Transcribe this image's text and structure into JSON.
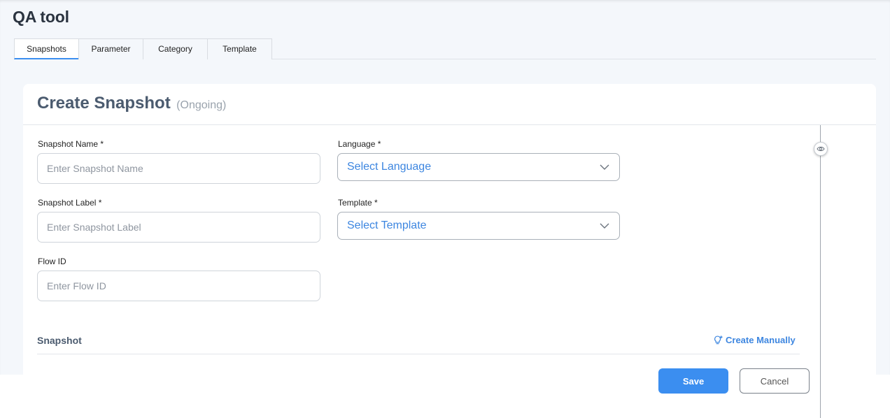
{
  "app": {
    "title": "QA tool"
  },
  "tabs": [
    {
      "label": "Snapshots",
      "active": true
    },
    {
      "label": "Parameter",
      "active": false
    },
    {
      "label": "Category",
      "active": false
    },
    {
      "label": "Template",
      "active": false
    }
  ],
  "card": {
    "title": "Create Snapshot",
    "status": "(Ongoing)"
  },
  "form": {
    "snapshot_name": {
      "label": "Snapshot Name *",
      "placeholder": "Enter Snapshot Name",
      "value": ""
    },
    "snapshot_label": {
      "label": "Snapshot Label *",
      "placeholder": "Enter Snapshot Label",
      "value": ""
    },
    "flow_id": {
      "label": "Flow ID",
      "placeholder": "Enter Flow ID",
      "value": ""
    },
    "language": {
      "label": "Language *",
      "value": "Select Language"
    },
    "template": {
      "label": "Template *",
      "value": "Select Template"
    }
  },
  "snapshot_section": {
    "title": "Snapshot",
    "create_manually_label": "Create Manually",
    "create_manually_icon": "bulb-plus-icon"
  },
  "side_panel": {
    "toggle_icon": "eye-icon"
  },
  "actions": {
    "save_label": "Save",
    "cancel_label": "Cancel"
  },
  "colors": {
    "accent": "#3b8ef0",
    "link": "#3d86e0",
    "heading": "#4b5b6f"
  }
}
